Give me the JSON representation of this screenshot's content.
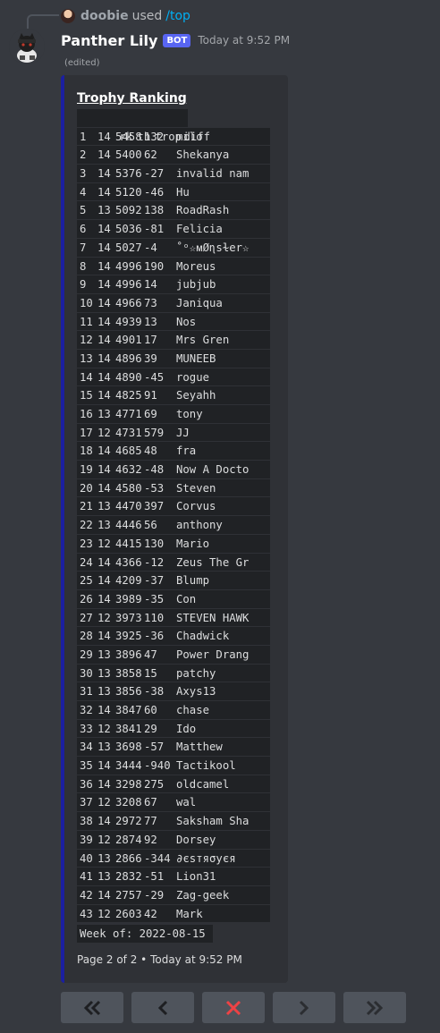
{
  "reply": {
    "user": "doobie",
    "used": "used",
    "command": "/top"
  },
  "message": {
    "username": "Panther Lily",
    "bot_tag": "BOT",
    "timestamp": "Today at 9:52 PM",
    "edited": "(edited)"
  },
  "embed": {
    "title": "Trophy Ranking",
    "accent_color": "#1b1fa0",
    "columns": [
      "rk",
      "th",
      "trop",
      "diff"
    ],
    "rows": [
      [
        "1",
        "14",
        "5458",
        "132",
        "milo"
      ],
      [
        "2",
        "14",
        "5400",
        "62",
        "Shekanya"
      ],
      [
        "3",
        "14",
        "5376",
        "-27",
        "invalid nam"
      ],
      [
        "4",
        "14",
        "5120",
        "-46",
        "Hu"
      ],
      [
        "5",
        "13",
        "5092",
        "138",
        "RoadRash"
      ],
      [
        "6",
        "14",
        "5036",
        "-81",
        "Felicia"
      ],
      [
        "7",
        "14",
        "5027",
        "-4",
        "˚ᵒ☆ᴍØɳsɫer☆"
      ],
      [
        "8",
        "14",
        "4996",
        "190",
        "Moreus"
      ],
      [
        "9",
        "14",
        "4996",
        "14",
        "jubjub"
      ],
      [
        "10",
        "14",
        "4966",
        "73",
        "Janiqua"
      ],
      [
        "11",
        "14",
        "4939",
        "13",
        "Nos"
      ],
      [
        "12",
        "14",
        "4901",
        "17",
        "Mrs Gren"
      ],
      [
        "13",
        "14",
        "4896",
        "39",
        "MUNEEB"
      ],
      [
        "14",
        "14",
        "4890",
        "-45",
        "rogue"
      ],
      [
        "15",
        "14",
        "4825",
        "91",
        "Seyahh"
      ],
      [
        "16",
        "13",
        "4771",
        "69",
        "tony"
      ],
      [
        "17",
        "12",
        "4731",
        "579",
        "JJ"
      ],
      [
        "18",
        "14",
        "4685",
        "48",
        "fra"
      ],
      [
        "19",
        "14",
        "4632",
        "-48",
        "Now A Docto"
      ],
      [
        "20",
        "14",
        "4580",
        "-53",
        "Steven"
      ],
      [
        "21",
        "13",
        "4470",
        "397",
        "Corvus"
      ],
      [
        "22",
        "13",
        "4446",
        "56",
        "anthony"
      ],
      [
        "23",
        "12",
        "4415",
        "130",
        "Mario"
      ],
      [
        "24",
        "14",
        "4366",
        "-12",
        "Zeus The Gr"
      ],
      [
        "25",
        "14",
        "4209",
        "-37",
        "Blump"
      ],
      [
        "26",
        "14",
        "3989",
        "-35",
        "Con"
      ],
      [
        "27",
        "12",
        "3973",
        "110",
        "STEVEN HAWK"
      ],
      [
        "28",
        "14",
        "3925",
        "-36",
        "Chadwick"
      ],
      [
        "29",
        "13",
        "3896",
        "47",
        "Power Drang"
      ],
      [
        "30",
        "13",
        "3858",
        "15",
        "patchy"
      ],
      [
        "31",
        "13",
        "3856",
        "-38",
        "Axys13"
      ],
      [
        "32",
        "14",
        "3847",
        "60",
        "chase"
      ],
      [
        "33",
        "12",
        "3841",
        "29",
        "Ido"
      ],
      [
        "34",
        "13",
        "3698",
        "-57",
        "Matthew"
      ],
      [
        "35",
        "14",
        "3444",
        "-940",
        "Tactikool"
      ],
      [
        "36",
        "14",
        "3298",
        "275",
        "oldcamel"
      ],
      [
        "37",
        "12",
        "3208",
        "67",
        "wal"
      ],
      [
        "38",
        "14",
        "2972",
        "77",
        "Saksham Sha"
      ],
      [
        "39",
        "12",
        "2874",
        "92",
        "Dorsey"
      ],
      [
        "40",
        "13",
        "2866",
        "-344",
        "∂єѕтяσуєя"
      ],
      [
        "41",
        "13",
        "2832",
        "-51",
        "Lion31"
      ],
      [
        "42",
        "14",
        "2757",
        "-29",
        "Zag-geek"
      ],
      [
        "43",
        "12",
        "2603",
        "42",
        "Mark"
      ]
    ],
    "week_label": "Week of: 2022-08-15",
    "footer": {
      "page": "Page 2 of 2",
      "separator": "•",
      "time": "Today at 9:52 PM"
    }
  },
  "buttons": [
    {
      "icon": "double-chevron-left-icon",
      "name": "first-page-button"
    },
    {
      "icon": "chevron-left-icon",
      "name": "previous-page-button"
    },
    {
      "icon": "close-icon",
      "name": "close-button",
      "color": "#ed4245"
    },
    {
      "icon": "chevron-right-icon",
      "name": "next-page-button"
    },
    {
      "icon": "double-chevron-right-icon",
      "name": "last-page-button"
    }
  ]
}
